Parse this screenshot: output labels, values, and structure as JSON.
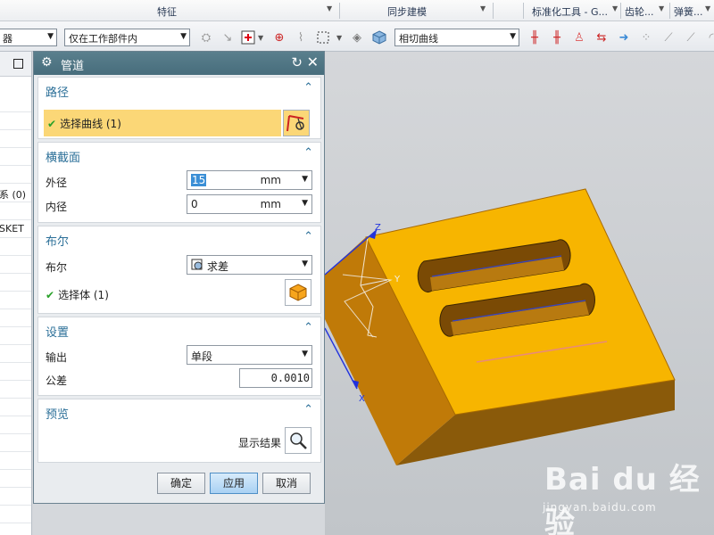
{
  "ribbon": {
    "feature": "特征",
    "sync_modeling": "同步建模",
    "std_tools": "标准化工具 - G...",
    "gear": "齿轮...",
    "spring": "弹簧..."
  },
  "toolbar": {
    "filter_partial": "器",
    "scope": "仅在工作部件内",
    "curve_rule": "相切曲线"
  },
  "nav": {
    "row_a": "系 (0)",
    "row_b": "SKET"
  },
  "dialog": {
    "title": "管道",
    "path": {
      "header": "路径",
      "select_curve": "选择曲线 (1)"
    },
    "cross_section": {
      "header": "横截面",
      "outer_label": "外径",
      "outer_value": "15",
      "outer_unit": "mm",
      "inner_label": "内径",
      "inner_value": "0",
      "inner_unit": "mm"
    },
    "boolean": {
      "header": "布尔",
      "label": "布尔",
      "value": "求差",
      "select_body": "选择体 (1)"
    },
    "settings": {
      "header": "设置",
      "output_label": "输出",
      "output_value": "单段",
      "tolerance_label": "公差",
      "tolerance_value": "0.0010"
    },
    "preview": {
      "header": "预览",
      "show_result": "显示结果"
    },
    "buttons": {
      "ok": "确定",
      "apply": "应用",
      "cancel": "取消"
    }
  },
  "viewport": {
    "axis_z": "Z",
    "axis_y": "Y",
    "axis_x": "X",
    "watermark": "Bai du 经验",
    "watermark_url": "jingyan.baidu.com"
  },
  "colors": {
    "accent": "#2b6f98",
    "title_bar": "#4f7584",
    "selection": "#fbd777",
    "part_face": "#f7b500"
  }
}
